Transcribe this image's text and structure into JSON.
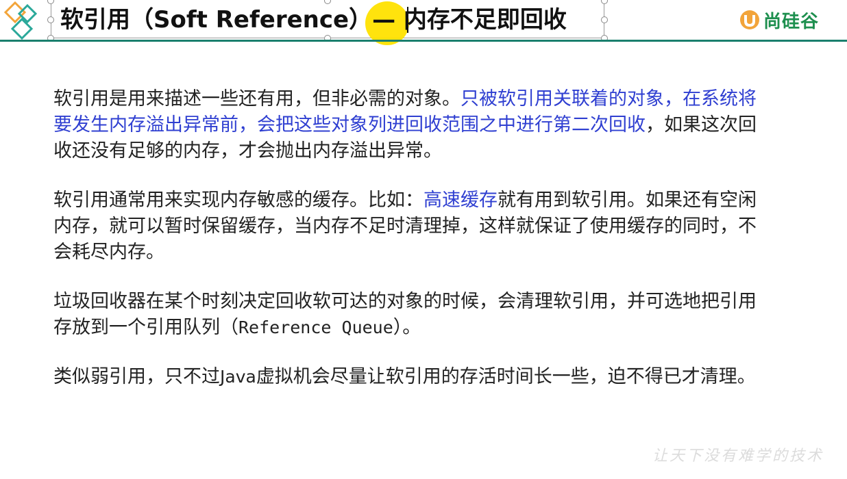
{
  "header": {
    "title": "软引用（Soft Reference）— 内存不足即回收",
    "brand_text": "尚硅谷",
    "accent_color": "#1a7f6e",
    "brand_color": "#1d8f4e",
    "logo_icon": "diamond-pattern-icon",
    "brand_icon": "brand-u-icon"
  },
  "paragraphs": {
    "p1": {
      "a": "软引用是用来描述一些还有用，但非必需的对象。",
      "b": "只被软引用关联着的对象，在系统将要发生内存溢出异常前，会把这些对象列进回收范围之中进行第二次回收",
      "c": "，如果这次回收还没有足够的内存，才会抛出内存溢出异常。"
    },
    "p2": {
      "a": "软引用通常用来实现内存敏感的缓存。比如：",
      "b": "高速缓存",
      "c": "就有用到软引用。如果还有空闲内存，就可以暂时保留缓存，当内存不足时清理掉，这样就保证了使用缓存的同时，不会耗尽内存。"
    },
    "p3": {
      "a": "垃圾回收器在某个时刻决定回收软可达的对象的时候，会清理软引用，并可选地把引用存放到一个引用队列（",
      "b": "Reference Queue",
      "c": "）。"
    },
    "p4": {
      "a": "类似弱引用，只不过",
      "b": "Java",
      "c": "虚拟机会尽量让软引用的存活时间长一些，迫不得已才清理。"
    }
  },
  "watermark": "让天下没有难学的技术",
  "highlight_color": "#2f3fd1"
}
